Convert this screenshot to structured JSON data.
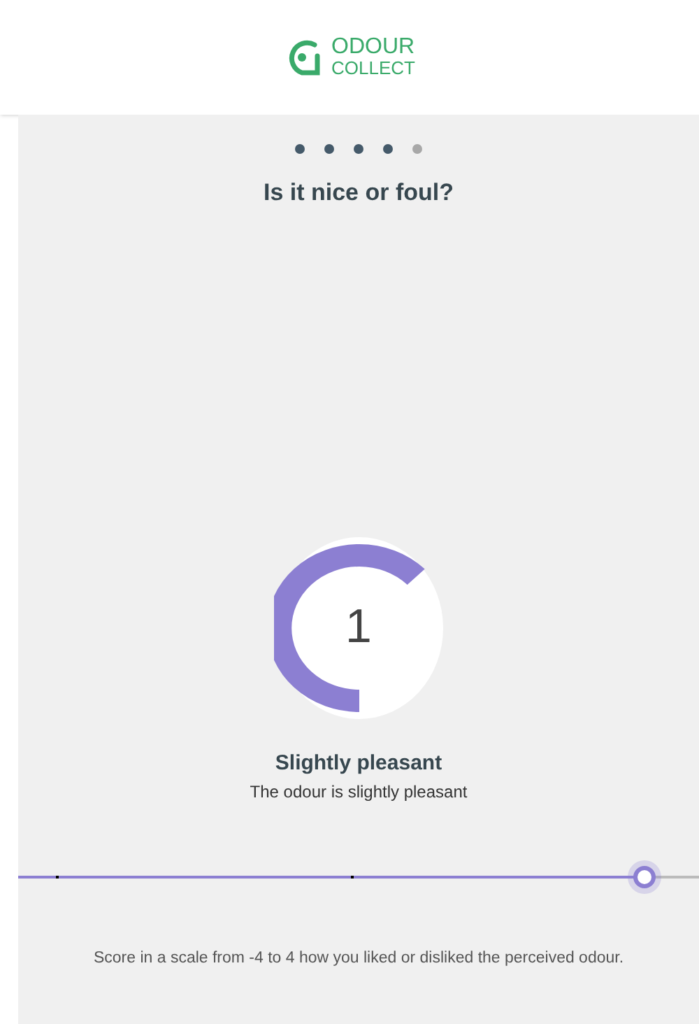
{
  "logo": {
    "line_1": "ODOUR",
    "line_2": "COLLECT"
  },
  "steps": [
    {
      "done": true
    },
    {
      "done": true
    },
    {
      "done": true
    },
    {
      "done": true
    },
    {
      "done": false
    }
  ],
  "question": "Is it nice or foul?",
  "gauge": {
    "value": "1",
    "level": 0.625
  },
  "rating": {
    "label": "Slightly pleasant",
    "description": "The odour is slightly pleasant"
  },
  "slider": {
    "level": 0.92
  },
  "hint": "Score in a scale from -4 to 4 how you liked or disliked the perceived odour."
}
